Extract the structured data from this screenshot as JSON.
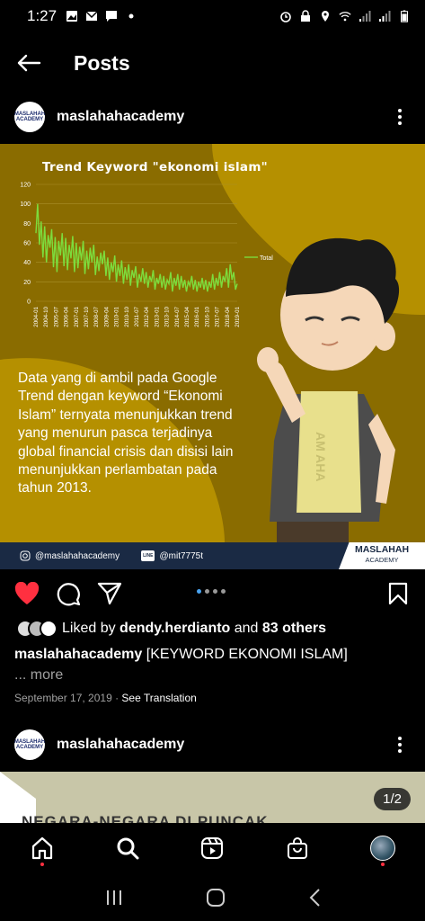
{
  "status_bar": {
    "time": "1:27"
  },
  "header": {
    "title": "Posts"
  },
  "post": {
    "username": "maslahahacademy",
    "avatar_text": "MASLAHAH ACADEMY",
    "infographic": {
      "body_text": "Data yang di ambil pada Google Trend dengan keyword “Ekonomi Islam” ternyata menunjukkan trend yang menurun pasca terjadinya global financial crisis dan disisi lain menunjukkan perlambatan pada tahun 2013.",
      "character_shirt_text": "AM AHA",
      "footer_instagram": "@maslahahacademy",
      "footer_line_badge": "LINE",
      "footer_line": "@mit7775t",
      "brand_name": "MASLAHAH",
      "brand_sub": "ACADEMY"
    },
    "carousel": {
      "dot_count": 4,
      "active": 0
    },
    "likes": {
      "prefix": "Liked by ",
      "user": "dendy.herdianto",
      "mid": " and ",
      "others": "83 others"
    },
    "caption": {
      "user": "maslahahacademy",
      "text": " [KEYWORD EKONOMI ISLAM]",
      "more": "... more"
    },
    "date": "September 17, 2019",
    "separator": " · ",
    "see_translation": "See Translation"
  },
  "post2": {
    "username": "maslahahacademy",
    "image_text": "NEGARA-NEGARA DI PUNCAK",
    "counter": "1/2"
  },
  "bottom_nav": {
    "items": [
      "home",
      "search",
      "reels",
      "shop",
      "profile"
    ]
  },
  "colors": {
    "accent_like": "#ff3040",
    "dot_active": "#4aa3f0",
    "infographic_bg": "#8a6c00",
    "footer": "#1a2a44",
    "chart_line": "#7ddc3c"
  },
  "chart_data": {
    "type": "line",
    "title": "Trend Keyword \"ekonomi islam\"",
    "ylim": [
      0,
      120
    ],
    "yticks": [
      0,
      20,
      40,
      60,
      80,
      100,
      120
    ],
    "xticks": [
      "2004-01",
      "2004-10",
      "2005-07",
      "2006-04",
      "2007-01",
      "2007-10",
      "2008-07",
      "2009-04",
      "2010-01",
      "2010-10",
      "2011-07",
      "2012-04",
      "2013-01",
      "2013-10",
      "2014-07",
      "2015-04",
      "2016-01",
      "2016-10",
      "2017-07",
      "2018-04",
      "2019-01"
    ],
    "series": [
      {
        "name": "Total",
        "values": [
          70,
          100,
          58,
          82,
          45,
          77,
          40,
          68,
          55,
          74,
          35,
          66,
          30,
          62,
          47,
          70,
          36,
          65,
          32,
          58,
          44,
          67,
          30,
          60,
          34,
          56,
          42,
          62,
          28,
          52,
          33,
          55,
          40,
          58,
          27,
          46,
          31,
          50,
          38,
          52,
          26,
          45,
          22,
          40,
          30,
          47,
          20,
          38,
          26,
          42,
          18,
          35,
          22,
          38,
          16,
          32,
          24,
          36,
          14,
          28,
          20,
          34,
          18,
          30,
          14,
          26,
          20,
          32,
          12,
          24,
          18,
          28,
          14,
          26,
          12,
          22,
          18,
          30,
          10,
          24,
          16,
          28,
          12,
          26,
          14,
          22,
          10,
          20,
          16,
          26,
          12,
          22,
          10,
          20,
          14,
          24,
          12,
          22,
          10,
          20,
          14,
          28,
          12,
          24,
          16,
          30,
          14,
          26,
          20,
          34,
          14,
          38,
          22,
          30,
          12,
          18
        ]
      }
    ]
  }
}
